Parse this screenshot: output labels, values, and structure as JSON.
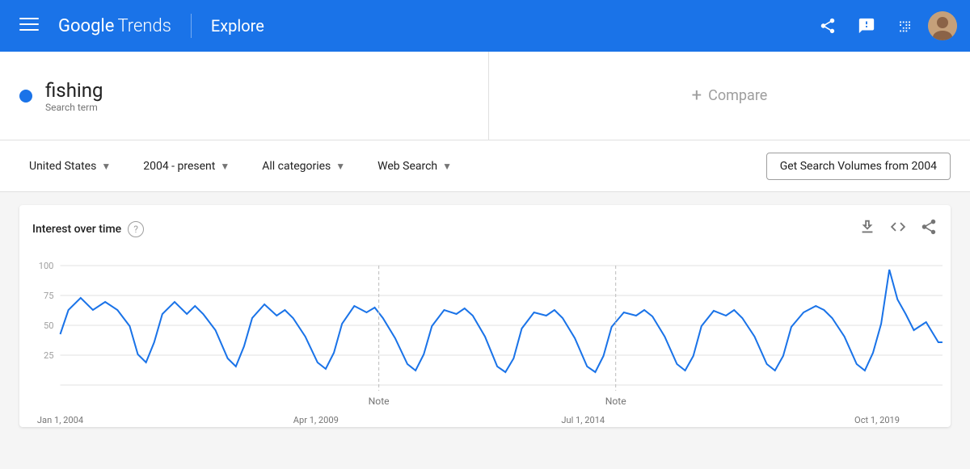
{
  "header": {
    "menu_label": "☰",
    "logo_google": "Google",
    "logo_trends": "Trends",
    "explore_label": "Explore",
    "share_icon": "share",
    "feedback_icon": "feedback",
    "apps_icon": "apps"
  },
  "search": {
    "term": "fishing",
    "term_type": "Search term",
    "compare_label": "Compare",
    "compare_icon": "+"
  },
  "filters": {
    "country": "United States",
    "time_range": "2004 - present",
    "category": "All categories",
    "search_type": "Web Search",
    "get_volumes_btn": "Get Search Volumes from 2004"
  },
  "chart": {
    "title": "Interest over time",
    "help_icon": "?",
    "download_icon": "download",
    "embed_icon": "<>",
    "share_icon": "share",
    "y_labels": [
      "100",
      "75",
      "50",
      "25"
    ],
    "x_labels": [
      "Jan 1, 2004",
      "Apr 1, 2009",
      "Jul 1, 2014",
      "Oct 1, 2019"
    ],
    "notes": [
      {
        "label": "Note",
        "position": "38"
      },
      {
        "label": "Note",
        "position": "63"
      }
    ]
  }
}
